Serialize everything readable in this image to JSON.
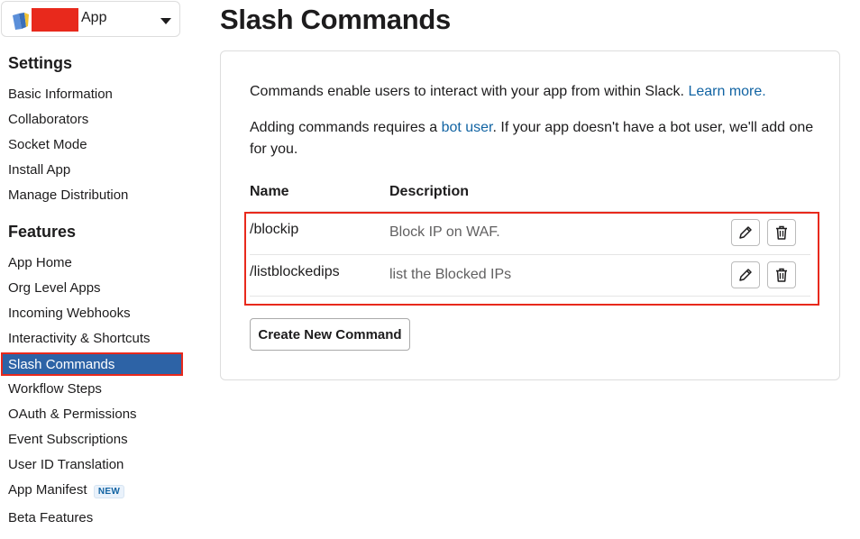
{
  "app_switcher": {
    "name": "App",
    "icon": "app-book-icon",
    "chevron": "chevron-down-icon"
  },
  "sidebar": {
    "settings_title": "Settings",
    "settings_items": [
      "Basic Information",
      "Collaborators",
      "Socket Mode",
      "Install App",
      "Manage Distribution"
    ],
    "features_title": "Features",
    "features_items": [
      "App Home",
      "Org Level Apps",
      "Incoming Webhooks",
      "Interactivity & Shortcuts",
      "Slash Commands",
      "Workflow Steps",
      "OAuth & Permissions",
      "Event Subscriptions",
      "User ID Translation",
      "App Manifest",
      "Beta Features"
    ],
    "active_item": "Slash Commands",
    "new_badge": "NEW"
  },
  "page": {
    "title": "Slash Commands",
    "intro_text": "Commands enable users to interact with your app from within Slack.",
    "learn_more": "Learn more.",
    "bot_text_1": "Adding commands requires a",
    "bot_link": "bot user",
    "bot_text_2": ". If your app doesn't have a bot user, we'll add one",
    "bot_text_3": "for you.",
    "col_name": "Name",
    "col_description": "Description",
    "commands": [
      {
        "name": "/blockip",
        "description": "Block IP on WAF."
      },
      {
        "name": "/listblockedips",
        "description": "list the Blocked IPs"
      }
    ],
    "create_button": "Create New Command"
  },
  "colors": {
    "accent": "#1264a3",
    "active_nav": "#2d63a6",
    "highlight_border": "#e8291c"
  }
}
